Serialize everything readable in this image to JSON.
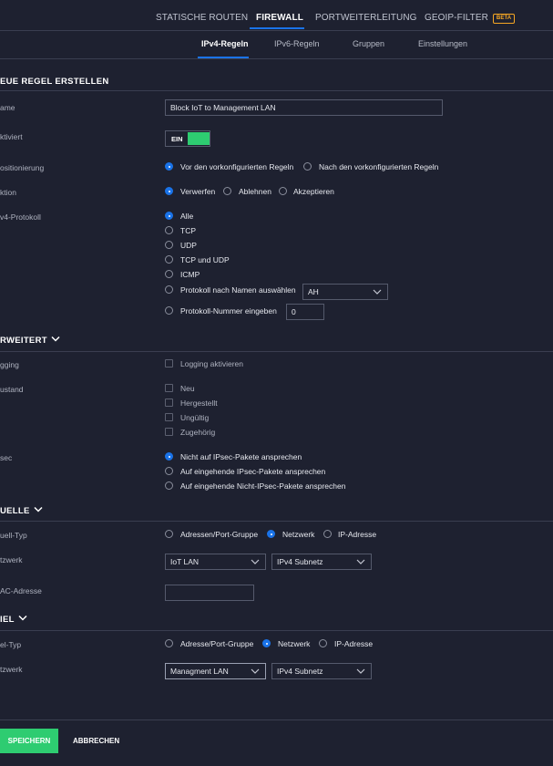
{
  "topnav": {
    "items": [
      "STATISCHE ROUTEN",
      "FIREWALL",
      "PORTWEITERLEITUNG",
      "GEOIP-FILTER"
    ],
    "beta_badge": "BETA",
    "active": "FIREWALL"
  },
  "subtabs": {
    "items": [
      "IPv4-Regeln",
      "IPv6-Regeln",
      "Gruppen",
      "Einstellungen"
    ],
    "active": "IPv4-Regeln"
  },
  "create": {
    "title": "EUE REGEL ERSTELLEN",
    "name_label": "ame",
    "name_value": "Block IoT to Management LAN",
    "enabled_label": "ktiviert",
    "enabled_value": "EIN",
    "position_label": "ositionierung",
    "position_options": [
      "Vor den vorkonfigurierten Regeln",
      "Nach den vorkonfigurierten Regeln"
    ],
    "position_selected": 0,
    "action_label": "ktion",
    "action_options": [
      "Verwerfen",
      "Ablehnen",
      "Akzeptieren"
    ],
    "action_selected": 0,
    "protocol_label": "v4-Protokoll",
    "protocol_options": [
      "Alle",
      "TCP",
      "UDP",
      "TCP und UDP",
      "ICMP",
      "Protokoll nach Namen auswählen",
      "Protokoll-Nummer eingeben"
    ],
    "protocol_selected": 0,
    "protocol_name_value": "AH",
    "protocol_number_value": "0"
  },
  "advanced": {
    "title": "RWEITERT",
    "logging_label": "gging",
    "logging_option": "Logging aktivieren",
    "state_label": "ustand",
    "state_options": [
      "Neu",
      "Hergestellt",
      "Ungültig",
      "Zugehörig"
    ],
    "ipsec_label": "sec",
    "ipsec_options": [
      "Nicht auf IPsec-Pakete ansprechen",
      "Auf eingehende IPsec-Pakete ansprechen",
      "Auf eingehende Nicht-IPsec-Pakete ansprechen"
    ],
    "ipsec_selected": 0
  },
  "source": {
    "title": "UELLE",
    "type_label": "uell-Typ",
    "type_options": [
      "Adressen/Port-Gruppe",
      "Netzwerk",
      "IP-Adresse"
    ],
    "type_selected": 1,
    "network_label": "tzwerk",
    "network_value": "IoT LAN",
    "subnet_value": "IPv4 Subnetz",
    "mac_label": "AC-Adresse",
    "mac_value": ""
  },
  "destination": {
    "title": "IEL",
    "type_label": "el-Typ",
    "type_options": [
      "Adresse/Port-Gruppe",
      "Netzwerk",
      "IP-Adresse"
    ],
    "type_selected": 1,
    "network_label": "tzwerk",
    "network_value": "Managment LAN",
    "subnet_value": "IPv4 Subnetz"
  },
  "footer": {
    "save_label": "SPEICHERN",
    "cancel_label": "ABBRECHEN"
  },
  "colors": {
    "background": "#1e2130",
    "accent_blue": "#1a73e8",
    "toggle_green": "#2ecc71",
    "beta_orange": "#f5a623"
  }
}
